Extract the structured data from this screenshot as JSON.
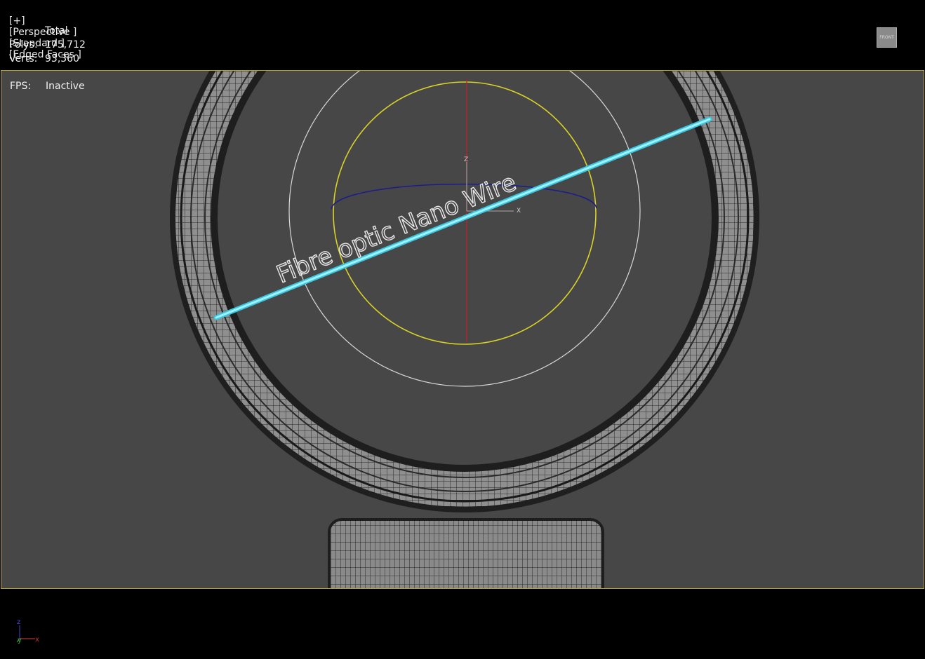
{
  "viewport_label": {
    "plus": "[+]",
    "view": "[Perspective ]",
    "shading": "[Standard ]",
    "edges": "[Edged Faces ]"
  },
  "stats": {
    "header": "Total",
    "polys_label": "Polys:",
    "polys_value": "175,712",
    "verts_label": "Verts:",
    "verts_value": "93,360"
  },
  "fps": {
    "label": "FPS:",
    "value": "Inactive"
  },
  "viewcube": {
    "label": "FRONT"
  },
  "scene": {
    "text_object": "Fibre optic Nano Wire",
    "gizmo_z": "Z",
    "gizmo_x": "X"
  },
  "axis_tripod": {
    "z": "z",
    "y": "y",
    "x": "x"
  },
  "colors": {
    "viewport_bg": "#474747",
    "viewport_border": "#b5a227",
    "wire_cyan": "#7fe8ff",
    "selection_yellow": "#d9d227",
    "gizmo_red": "#c0202a",
    "gizmo_blue": "#1c1c8a"
  }
}
